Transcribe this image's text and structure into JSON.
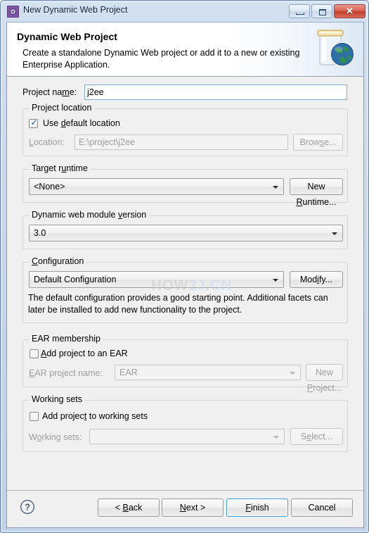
{
  "window": {
    "title": "New Dynamic Web Project",
    "icon": "gear-icon",
    "minimize_label": "Minimize",
    "maximize_label": "Maximize",
    "close_label": "✕"
  },
  "banner": {
    "title": "Dynamic Web Project",
    "description": "Create a standalone Dynamic Web project or add it to a new or existing Enterprise Application.",
    "art": "web-jar-globe-icon"
  },
  "form": {
    "project_name": {
      "label_pre": "Project na",
      "label_mnemonic": "m",
      "label_post": "e:",
      "value": "j2ee",
      "placeholder": ""
    },
    "project_location": {
      "legend": "Project location",
      "use_default": {
        "label_pre": "Use ",
        "label_mnemonic": "d",
        "label_post": "efault location",
        "checked": true
      },
      "location_label_pre": "",
      "location_label_mnemonic": "L",
      "location_label_post": "ocation:",
      "location_value": "E:\\project\\j2ee",
      "browse_pre": "Brow",
      "browse_mnemonic": "s",
      "browse_post": "e...",
      "enabled": false
    },
    "target_runtime": {
      "legend_pre": "Target r",
      "legend_mnemonic": "u",
      "legend_post": "ntime",
      "value": "<None>",
      "new_runtime_pre": "New ",
      "new_runtime_mnemonic": "R",
      "new_runtime_post": "untime..."
    },
    "module_version": {
      "legend_pre": "Dynamic web module ",
      "legend_mnemonic": "v",
      "legend_post": "ersion",
      "value": "3.0"
    },
    "configuration": {
      "legend_mnemonic": "C",
      "legend_post": "onfiguration",
      "value": "Default Configuration",
      "modify_pre": "Mod",
      "modify_mnemonic": "i",
      "modify_post": "fy...",
      "description": "The default configuration provides a good starting point. Additional facets can later be installed to add new functionality to the project."
    },
    "ear_membership": {
      "legend": "EAR membership",
      "add_to_ear": {
        "label_mnemonic": "A",
        "label_post": "dd project to an EAR",
        "checked": false
      },
      "ear_name_label_mnemonic": "E",
      "ear_name_label_post": "AR project name:",
      "ear_name_value": "EAR",
      "new_project_pre": "New ",
      "new_project_mnemonic": "P",
      "new_project_post": "roject...",
      "enabled": false
    },
    "working_sets": {
      "legend": "Working sets",
      "add_to_working_sets": {
        "label_pre": "Add projec",
        "label_mnemonic": "t",
        "label_post": " to working sets",
        "checked": false
      },
      "ws_label_pre": "W",
      "ws_label_mnemonic": "o",
      "ws_label_post": "rking sets:",
      "ws_value": "",
      "select_pre": "S",
      "select_mnemonic": "e",
      "select_post": "lect...",
      "enabled": false
    }
  },
  "watermark": {
    "part1": "HOW",
    "part2": "2J",
    "part3": ".",
    "part4": "CN"
  },
  "buttons": {
    "help": "?",
    "back_pre": "< ",
    "back_mnemonic": "B",
    "back_post": "ack",
    "next_mnemonic": "N",
    "next_post": "ext >",
    "finish_pre": "",
    "finish_mnemonic": "F",
    "finish_post": "inish",
    "cancel": "Cancel"
  },
  "colors": {
    "accent": "#3c9fd6",
    "title_bar": "#d3e0ef",
    "dialog_bg": "#f0f0f0",
    "close_button": "#c23d2c",
    "app_icon": "#7e57a4"
  }
}
